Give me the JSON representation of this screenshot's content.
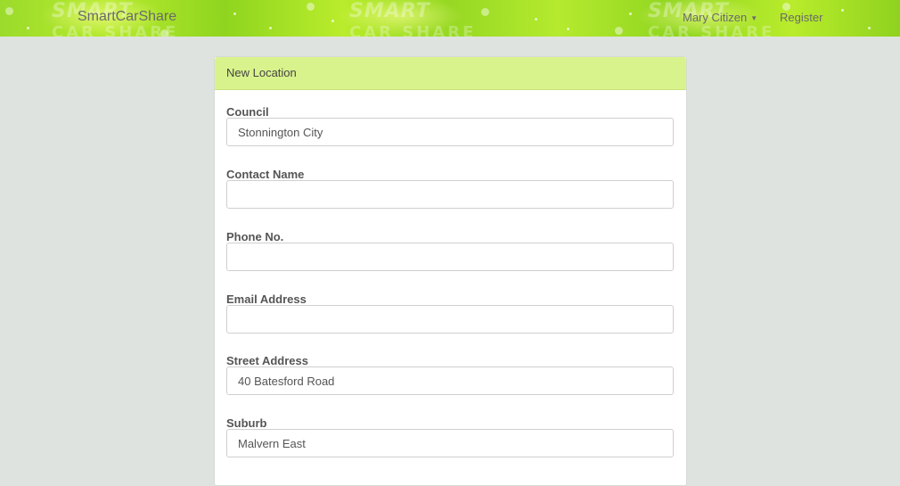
{
  "navbar": {
    "brand": "SmartCarShare",
    "user_menu": "Mary Citizen",
    "register": "Register",
    "watermark_top": "SMART",
    "watermark_bottom": "CAR SHARE",
    "accent_color": "#9bdb2b"
  },
  "panel": {
    "title": "New Location",
    "header_color": "#d9f38c"
  },
  "form": {
    "council": {
      "label": "Council",
      "value": "Stonnington City"
    },
    "contact_name": {
      "label": "Contact Name",
      "value": ""
    },
    "phone": {
      "label": "Phone No.",
      "value": ""
    },
    "email": {
      "label": "Email Address",
      "value": ""
    },
    "street": {
      "label": "Street Address",
      "value": "40 Batesford Road"
    },
    "suburb": {
      "label": "Suburb",
      "value": "Malvern East"
    }
  }
}
